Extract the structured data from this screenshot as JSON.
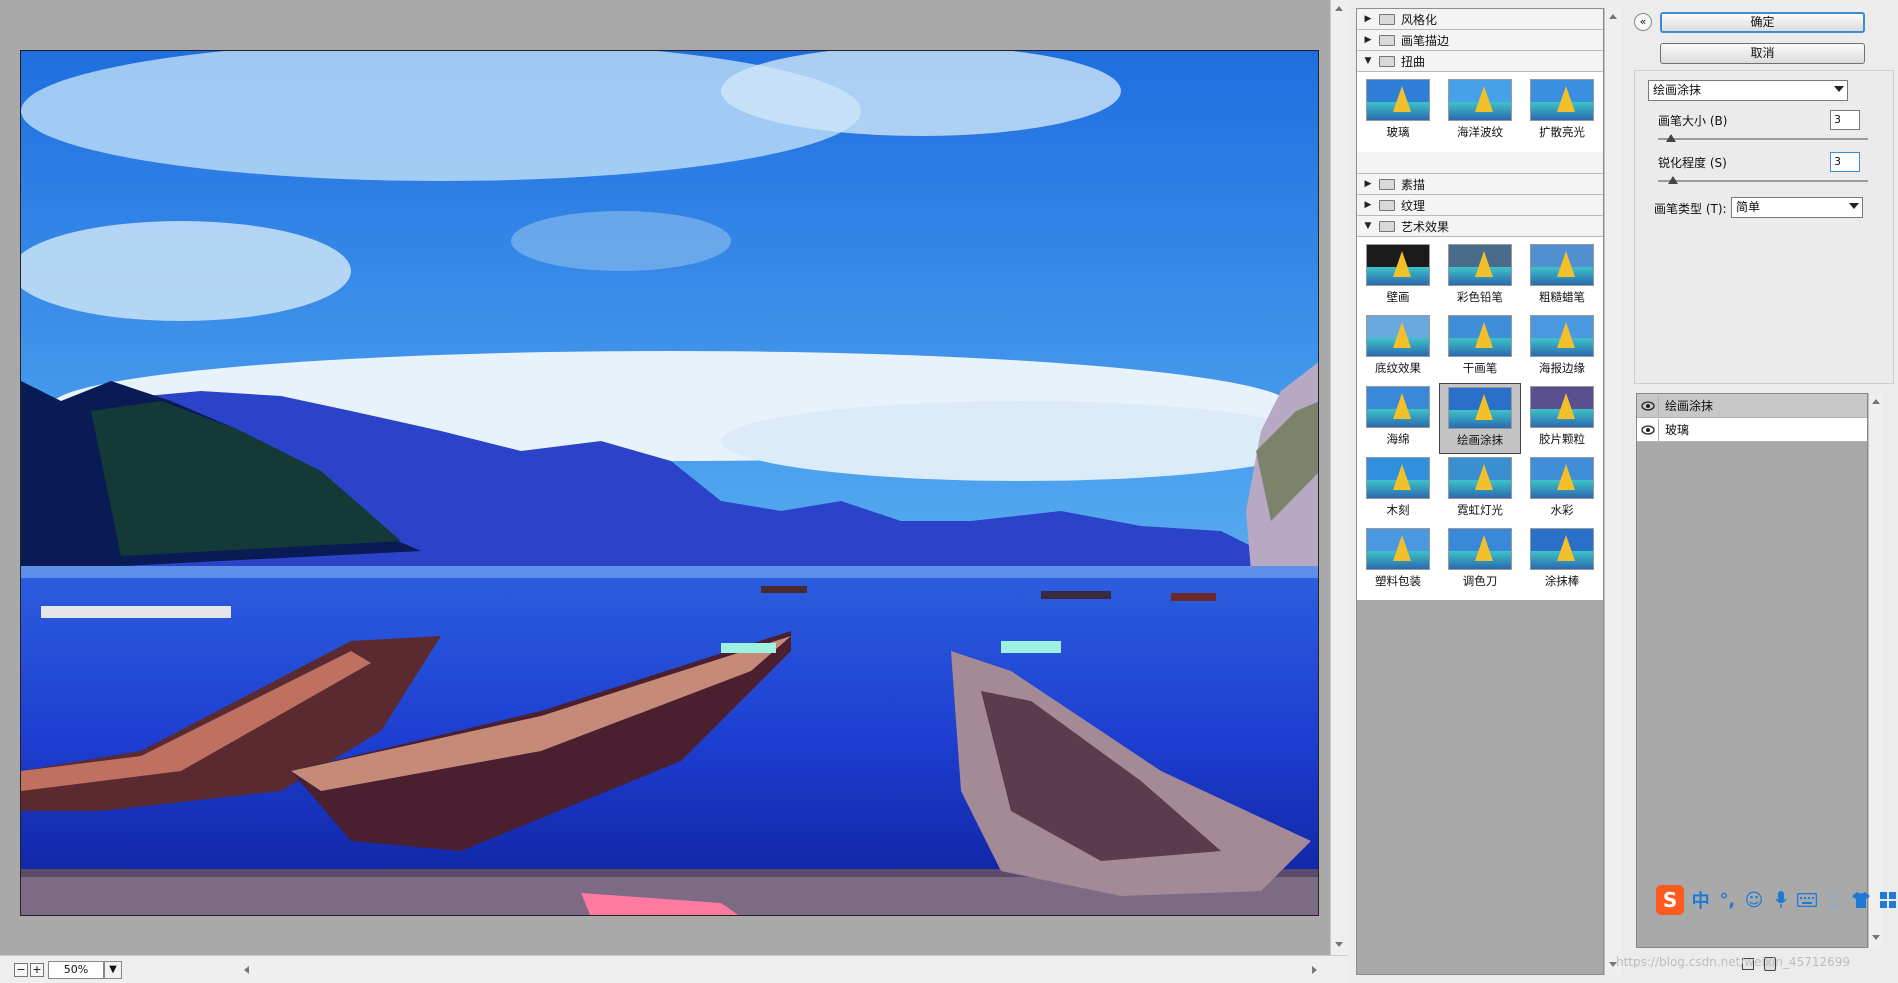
{
  "preview": {
    "zoom_value": "50%",
    "zoom_out_label": "−",
    "zoom_in_label": "+"
  },
  "filter_categories": [
    {
      "label": "风格化",
      "expanded": false
    },
    {
      "label": "画笔描边",
      "expanded": false
    },
    {
      "label": "扭曲",
      "expanded": true,
      "filters": [
        "玻璃",
        "海洋波纹",
        "扩散亮光"
      ]
    },
    {
      "label": "素描",
      "expanded": false
    },
    {
      "label": "纹理",
      "expanded": false
    },
    {
      "label": "艺术效果",
      "expanded": true,
      "filters": [
        "壁画",
        "彩色铅笔",
        "粗糙蜡笔",
        "底纹效果",
        "干画笔",
        "海报边缘",
        "海绵",
        "绘画涂抹",
        "胶片颗粒",
        "木刻",
        "霓虹灯光",
        "水彩",
        "塑料包装",
        "调色刀",
        "涂抹棒"
      ],
      "selected": "绘画涂抹"
    }
  ],
  "buttons": {
    "ok": "确定",
    "cancel": "取消"
  },
  "filter_select": {
    "value": "绘画涂抹"
  },
  "params": {
    "brush_size": {
      "label": "画笔大小 (B)",
      "value": "3",
      "slider_fraction": 0.06
    },
    "sharpness": {
      "label": "锐化程度 (S)",
      "value": "3",
      "slider_fraction": 0.07
    },
    "brush_type": {
      "label": "画笔类型 (T):",
      "value": "简单"
    }
  },
  "effect_layers": [
    {
      "label": "绘画涂抹",
      "active": true
    },
    {
      "label": "玻璃",
      "active": false
    }
  ],
  "ime": {
    "logo": "S",
    "lang": "中",
    "punct": "°,"
  },
  "watermark": "https://blog.csdn.net/weixin_45712699",
  "colors": {
    "panel_gray": "#a9a9a9",
    "ok_border": "#3d8bd6",
    "sky": "#3f8fe6"
  }
}
